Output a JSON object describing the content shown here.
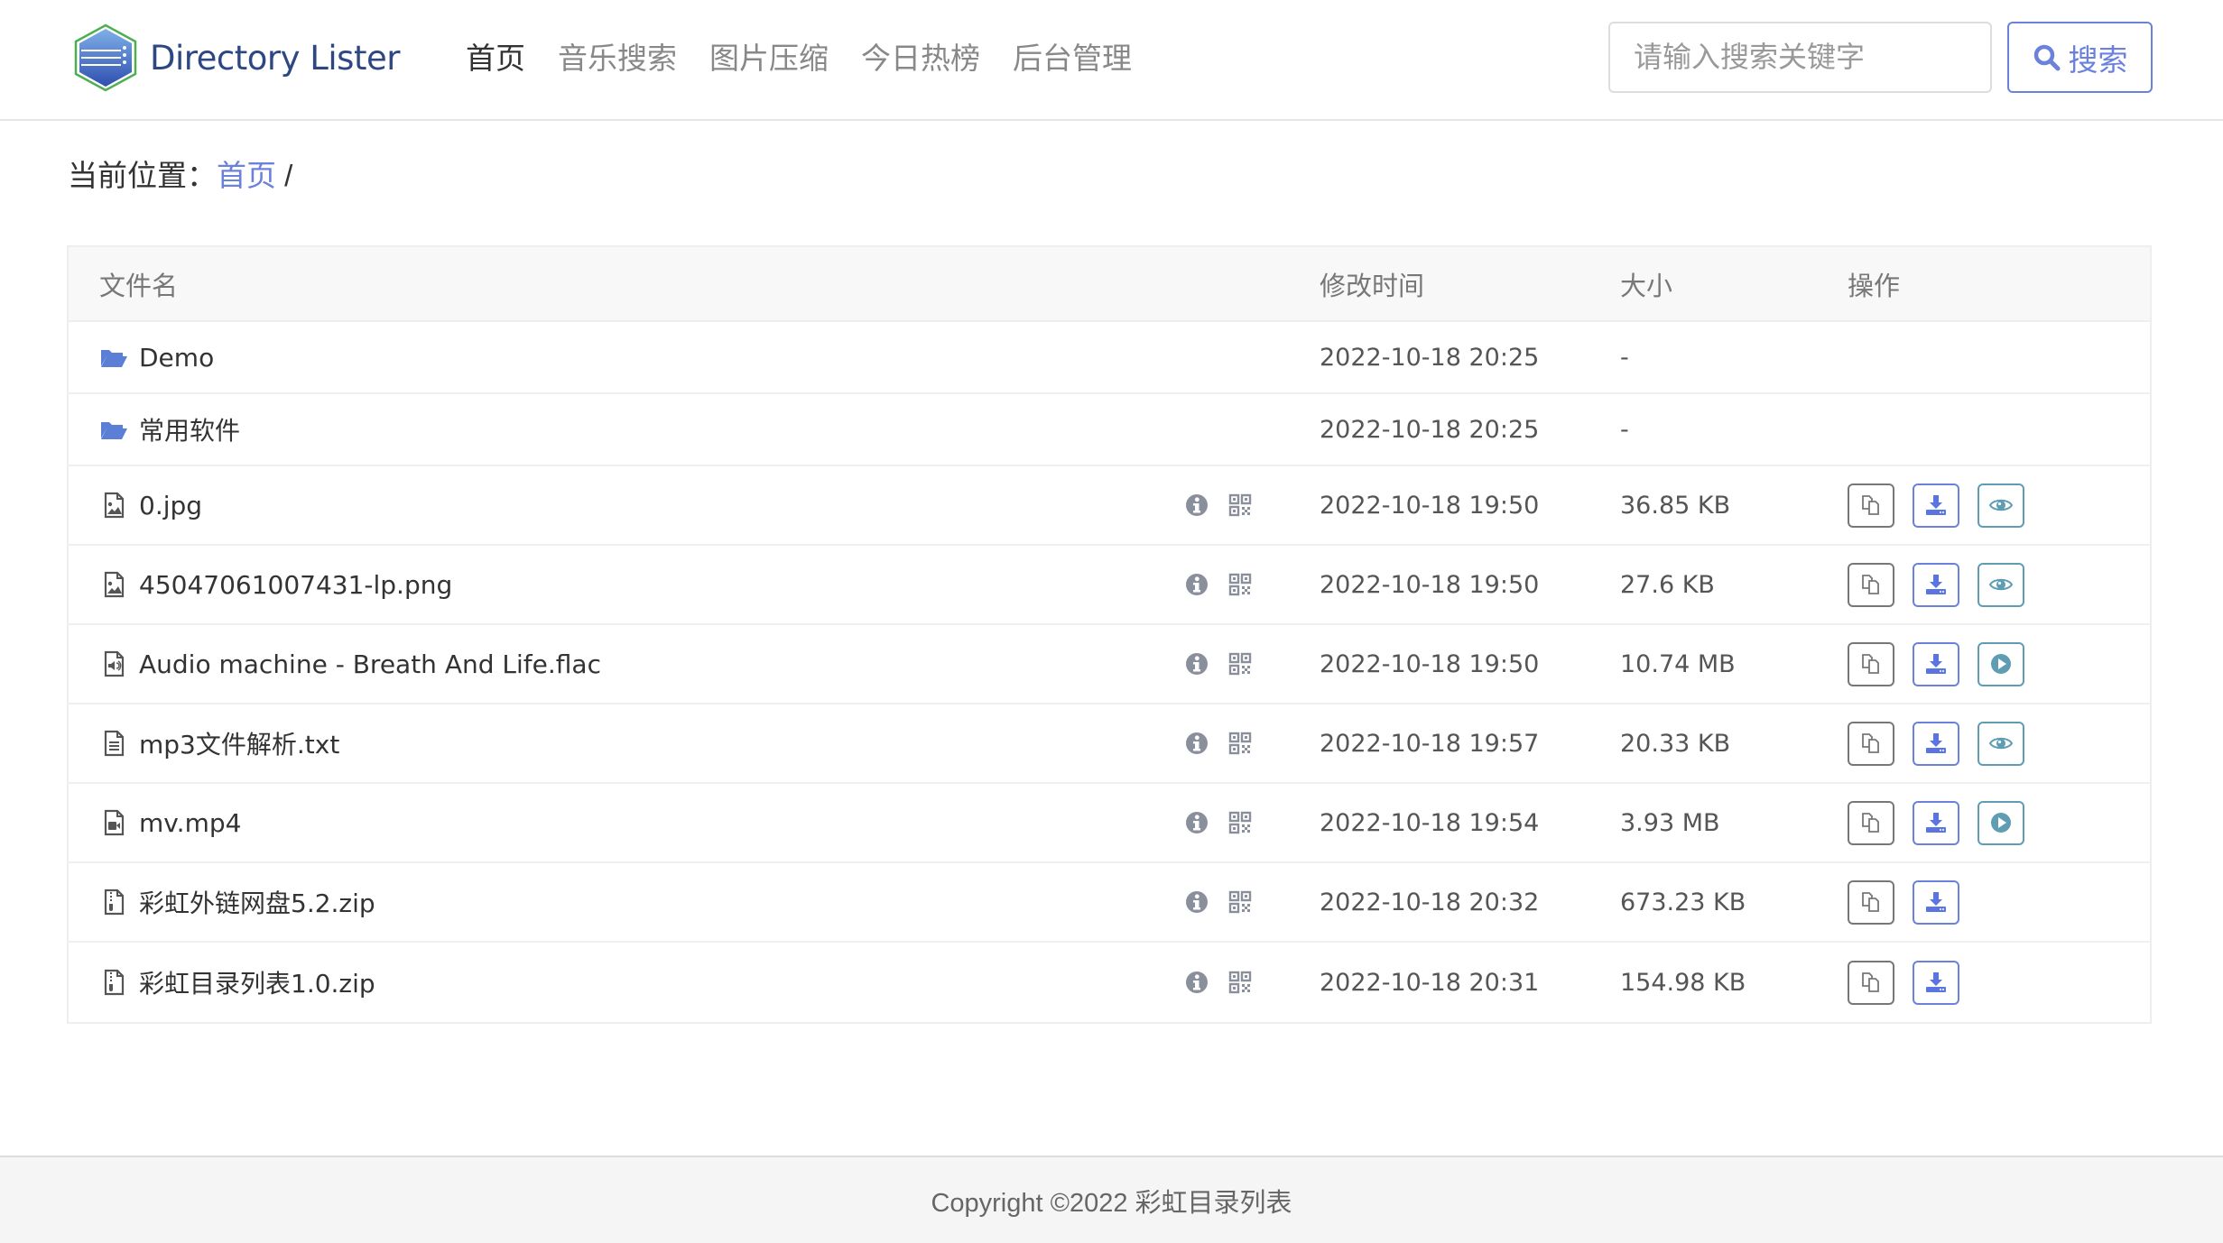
{
  "header": {
    "logo_text": "Directory Lister",
    "nav": [
      {
        "label": "首页",
        "active": true
      },
      {
        "label": "音乐搜索",
        "active": false
      },
      {
        "label": "图片压缩",
        "active": false
      },
      {
        "label": "今日热榜",
        "active": false
      },
      {
        "label": "后台管理",
        "active": false
      }
    ],
    "search_placeholder": "请输入搜索关键字",
    "search_value": "",
    "search_button": "搜索"
  },
  "breadcrumb": {
    "prefix": "当前位置：",
    "home": "首页",
    "separator": "/"
  },
  "table": {
    "columns": [
      "文件名",
      "修改时间",
      "大小",
      "操作"
    ],
    "rows": [
      {
        "type": "folder",
        "icon": "folder-open-icon",
        "name": "Demo",
        "modified": "2022-10-18 20:25",
        "size": "-",
        "actions": []
      },
      {
        "type": "folder",
        "icon": "folder-open-icon",
        "name": "常用软件",
        "modified": "2022-10-18 20:25",
        "size": "-",
        "actions": []
      },
      {
        "type": "file",
        "icon": "file-image-icon",
        "name": "0.jpg",
        "modified": "2022-10-18 19:50",
        "size": "36.85 KB",
        "actions": [
          "copy",
          "download",
          "preview"
        ]
      },
      {
        "type": "file",
        "icon": "file-image-icon",
        "name": "45047061007431-lp.png",
        "modified": "2022-10-18 19:50",
        "size": "27.6 KB",
        "actions": [
          "copy",
          "download",
          "preview"
        ]
      },
      {
        "type": "file",
        "icon": "file-audio-icon",
        "name": "Audio machine - Breath And Life.flac",
        "modified": "2022-10-18 19:50",
        "size": "10.74 MB",
        "actions": [
          "copy",
          "download",
          "play"
        ]
      },
      {
        "type": "file",
        "icon": "file-text-icon",
        "name": "mp3文件解析.txt",
        "modified": "2022-10-18 19:57",
        "size": "20.33 KB",
        "actions": [
          "copy",
          "download",
          "preview"
        ]
      },
      {
        "type": "file",
        "icon": "file-video-icon",
        "name": "mv.mp4",
        "modified": "2022-10-18 19:54",
        "size": "3.93 MB",
        "actions": [
          "copy",
          "download",
          "play"
        ]
      },
      {
        "type": "file",
        "icon": "file-archive-icon",
        "name": "彩虹外链网盘5.2.zip",
        "modified": "2022-10-18 20:32",
        "size": "673.23 KB",
        "actions": [
          "copy",
          "download"
        ]
      },
      {
        "type": "file",
        "icon": "file-archive-icon",
        "name": "彩虹目录列表1.0.zip",
        "modified": "2022-10-18 20:31",
        "size": "154.98 KB",
        "actions": [
          "copy",
          "download"
        ]
      }
    ]
  },
  "footer": {
    "text": "Copyright ©2022 彩虹目录列表"
  },
  "colors": {
    "accent": "#6b82dd",
    "preview": "#5e9db2",
    "icon_gray": "#8a8f9c",
    "folder": "#5b7fd6"
  }
}
